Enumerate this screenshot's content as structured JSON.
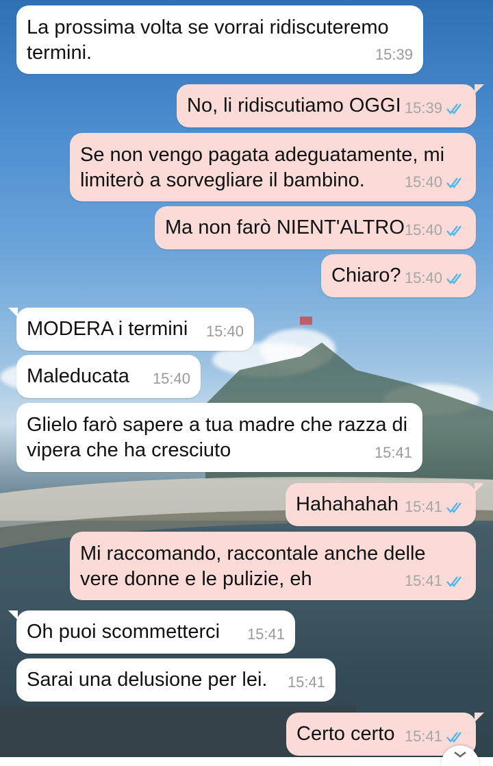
{
  "chat": {
    "messages": [
      {
        "dir": "in",
        "text_lines": [
          "La prossima volta se vorrai ridiscuteremo",
          "termini."
        ],
        "time": "15:39"
      },
      {
        "dir": "out",
        "text_lines": [
          "No, li ridiscutiamo OGGI"
        ],
        "time": "15:39",
        "read": true
      },
      {
        "dir": "out",
        "text_lines": [
          "Se non vengo pagata adeguatamente, mi",
          "limiterò a sorvegliare il bambino."
        ],
        "time": "15:40",
        "read": true
      },
      {
        "dir": "out",
        "text_lines": [
          "Ma non farò NIENT'ALTRO"
        ],
        "time": "15:40",
        "read": true
      },
      {
        "dir": "out",
        "text_lines": [
          "Chiaro?"
        ],
        "time": "15:40",
        "read": true
      },
      {
        "dir": "in",
        "text_lines": [
          "MODERA i termini"
        ],
        "time": "15:40"
      },
      {
        "dir": "in",
        "text_lines": [
          "Maleducata"
        ],
        "time": "15:40"
      },
      {
        "dir": "in",
        "text_lines": [
          "Glielo farò sapere a tua madre che razza di",
          "vipera che ha cresciuto"
        ],
        "time": "15:41"
      },
      {
        "dir": "out",
        "text_lines": [
          "Hahahahah"
        ],
        "time": "15:41",
        "read": true
      },
      {
        "dir": "out",
        "text_lines": [
          "Mi raccomando, raccontale anche delle",
          "vere donne e le pulizie, eh"
        ],
        "time": "15:41",
        "read": true
      },
      {
        "dir": "in",
        "text_lines": [
          "Oh puoi scommetterci"
        ],
        "time": "15:41"
      },
      {
        "dir": "in",
        "text_lines": [
          "Sarai una delusione per lei."
        ],
        "time": "15:41"
      },
      {
        "dir": "out",
        "text_lines": [
          "Certo certo"
        ],
        "time": "15:41",
        "read": true
      }
    ]
  },
  "colors": {
    "incoming_bubble": "#ffffff",
    "outgoing_bubble": "#fadbd8",
    "read_tick": "#4fb6ec"
  },
  "icons": {
    "read_receipt": "double-check-icon",
    "scroll_down": "chevron-down-icon"
  }
}
